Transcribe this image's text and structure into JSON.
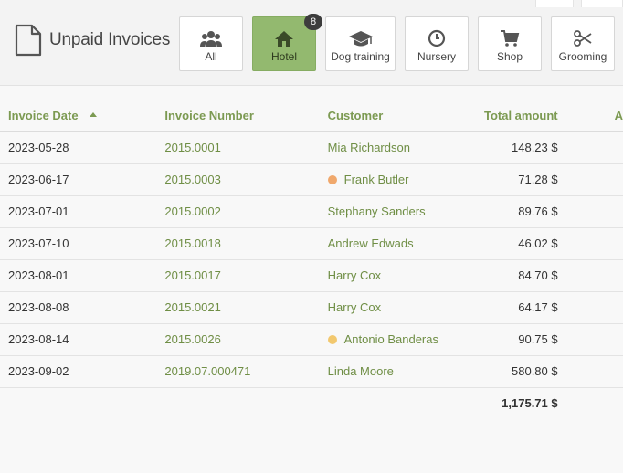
{
  "header": {
    "title": "Unpaid Invoices",
    "tabs": [
      {
        "label": "All",
        "icon": "users-icon",
        "active": false
      },
      {
        "label": "Hotel",
        "icon": "home-icon",
        "active": true,
        "badge": "8"
      },
      {
        "label": "Dog training",
        "icon": "graduation-cap-icon",
        "active": false
      },
      {
        "label": "Nursery",
        "icon": "clock-icon",
        "active": false
      },
      {
        "label": "Shop",
        "icon": "cart-icon",
        "active": false
      },
      {
        "label": "Grooming",
        "icon": "scissors-icon",
        "active": false
      }
    ]
  },
  "table": {
    "columns": {
      "date": "Invoice Date",
      "number": "Invoice Number",
      "customer": "Customer",
      "amount": "Total amount",
      "extra": "A"
    },
    "sort": {
      "column": "date",
      "direction": "ascending"
    },
    "rows": [
      {
        "date": "2023-05-28",
        "number": "2015.0001",
        "customer": "Mia Richardson",
        "amount": "148.23 $",
        "dot": ""
      },
      {
        "date": "2023-06-17",
        "number": "2015.0003",
        "customer": "Frank Butler",
        "amount": "71.28 $",
        "dot": "#f0a86c"
      },
      {
        "date": "2023-07-01",
        "number": "2015.0002",
        "customer": "Stephany Sanders",
        "amount": "89.76 $",
        "dot": ""
      },
      {
        "date": "2023-07-10",
        "number": "2015.0018",
        "customer": "Andrew Edwads",
        "amount": "46.02 $",
        "dot": ""
      },
      {
        "date": "2023-08-01",
        "number": "2015.0017",
        "customer": "Harry Cox",
        "amount": "84.70 $",
        "dot": ""
      },
      {
        "date": "2023-08-08",
        "number": "2015.0021",
        "customer": "Harry Cox",
        "amount": "64.17 $",
        "dot": ""
      },
      {
        "date": "2023-08-14",
        "number": "2015.0026",
        "customer": "Antonio Banderas",
        "amount": "90.75 $",
        "dot": "#f2c86e"
      },
      {
        "date": "2023-09-02",
        "number": "2019.07.000471",
        "customer": "Linda Moore",
        "amount": "580.80 $",
        "dot": ""
      }
    ],
    "total": "1,175.71 $"
  },
  "colors": {
    "accent": "#7c9a52",
    "active_tab": "#93b96f"
  }
}
